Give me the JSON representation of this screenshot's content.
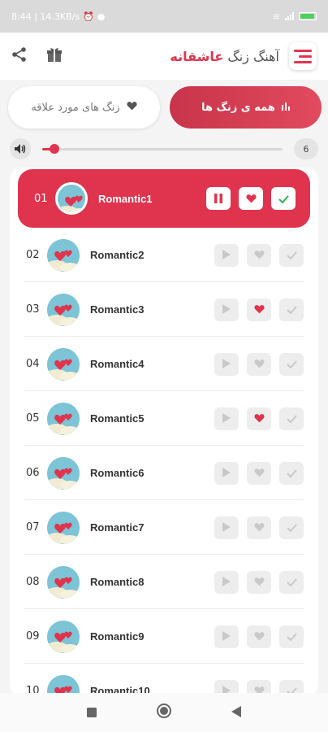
{
  "status": {
    "text": "8:44 | 14.3KB/s"
  },
  "header": {
    "title_accent": "عاشقانه",
    "title_plain": "آهنگ زنگ"
  },
  "tabs": {
    "favorites_label": "زنگ های مورد علاقه",
    "all_label": "همه ی زنگ ها"
  },
  "volume": {
    "value": "6",
    "level": 0.05
  },
  "colors": {
    "accent": "#e0344e",
    "avatar_bg": "#7cc4d6",
    "inactive": "#ededed"
  },
  "tracks": [
    {
      "num": "01",
      "title": "Romantic1",
      "active": true,
      "playing": true,
      "liked": true
    },
    {
      "num": "02",
      "title": "Romantic2",
      "active": false,
      "liked": false
    },
    {
      "num": "03",
      "title": "Romantic3",
      "active": false,
      "liked": true
    },
    {
      "num": "04",
      "title": "Romantic4",
      "active": false,
      "liked": false
    },
    {
      "num": "05",
      "title": "Romantic5",
      "active": false,
      "liked": true
    },
    {
      "num": "06",
      "title": "Romantic6",
      "active": false,
      "liked": false
    },
    {
      "num": "07",
      "title": "Romantic7",
      "active": false,
      "liked": false
    },
    {
      "num": "08",
      "title": "Romantic8",
      "active": false,
      "liked": false
    },
    {
      "num": "09",
      "title": "Romantic9",
      "active": false,
      "liked": false
    },
    {
      "num": "10",
      "title": "Romantic10",
      "active": false,
      "liked": false
    }
  ],
  "icons": {
    "share": "share-icon",
    "gift": "gift-icon",
    "menu": "menu-icon",
    "heart": "heart-icon",
    "bars": "equalizer-icon",
    "volume": "volume-icon",
    "play": "play-icon",
    "pause": "pause-icon",
    "check": "check-icon"
  }
}
